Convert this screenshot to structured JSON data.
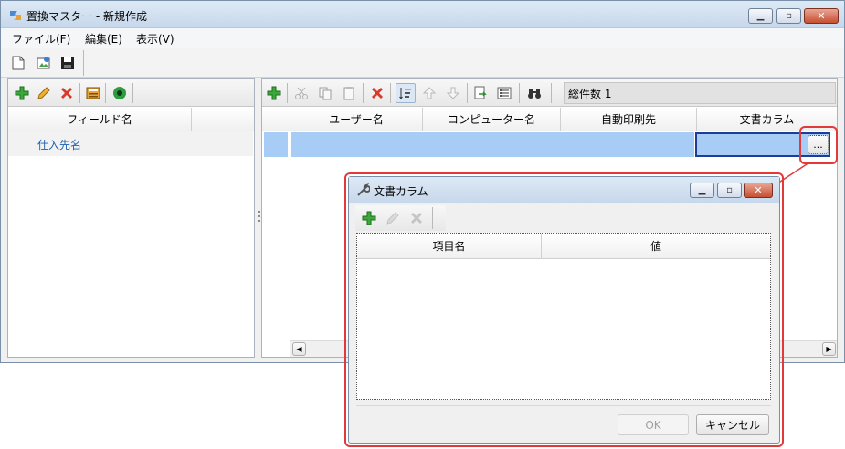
{
  "main_window": {
    "title": "置換マスター - 新規作成",
    "menu": [
      "ファイル(F)",
      "編集(E)",
      "表示(V)"
    ]
  },
  "left_panel": {
    "columns": [
      "フィールド名"
    ],
    "rows": [
      "仕入先名"
    ]
  },
  "right_panel": {
    "count_label": "総件数 1",
    "columns": [
      "ユーザー名",
      "コンピューター名",
      "自動印刷先",
      "文書カラム"
    ],
    "ellipsis": "..."
  },
  "dialog": {
    "title": "文書カラム",
    "columns": [
      "項目名",
      "値"
    ],
    "ok_label": "OK",
    "cancel_label": "キャンセル"
  },
  "colors": {
    "accent_red": "#e03a3a",
    "selection": "#a7cdf7"
  }
}
